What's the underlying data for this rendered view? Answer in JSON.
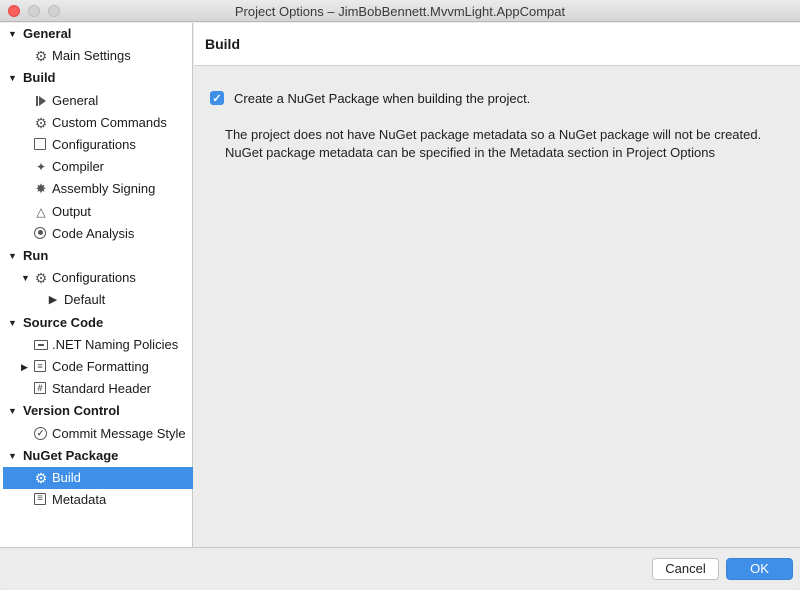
{
  "window": {
    "title": "Project Options – JimBobBennett.MvvmLight.AppCompat"
  },
  "sidebar": {
    "rows": [
      {
        "type": "section",
        "label": "General",
        "arrow": "down"
      },
      {
        "type": "item",
        "label": "Main Settings",
        "icon": "gear-icon"
      },
      {
        "type": "section",
        "label": "Build",
        "arrow": "down"
      },
      {
        "type": "item",
        "label": "General",
        "icon": "play-icon"
      },
      {
        "type": "item",
        "label": "Custom Commands",
        "icon": "gear-icon"
      },
      {
        "type": "item",
        "label": "Configurations",
        "icon": "window-icon"
      },
      {
        "type": "item",
        "label": "Compiler",
        "icon": "compiler-icon"
      },
      {
        "type": "item",
        "label": "Assembly Signing",
        "icon": "seal-icon"
      },
      {
        "type": "item",
        "label": "Output",
        "icon": "flask-icon"
      },
      {
        "type": "item",
        "label": "Code Analysis",
        "icon": "target-icon"
      },
      {
        "type": "section",
        "label": "Run",
        "arrow": "down"
      },
      {
        "type": "item",
        "label": "Configurations",
        "icon": "gear-icon",
        "arrow": "down"
      },
      {
        "type": "subitem",
        "label": "Default",
        "icon": "play-triangle-icon"
      },
      {
        "type": "section",
        "label": "Source Code",
        "arrow": "down"
      },
      {
        "type": "item",
        "label": ".NET Naming Policies",
        "icon": "naming-icon"
      },
      {
        "type": "item",
        "label": "Code Formatting",
        "icon": "formatting-icon",
        "arrow": "right"
      },
      {
        "type": "item",
        "label": "Standard Header",
        "icon": "hash-icon"
      },
      {
        "type": "section",
        "label": "Version Control",
        "arrow": "down"
      },
      {
        "type": "item",
        "label": "Commit Message Style",
        "icon": "check-circle-icon"
      },
      {
        "type": "section",
        "label": "NuGet Package",
        "arrow": "down"
      },
      {
        "type": "item",
        "label": "Build",
        "icon": "gear-icon",
        "selected": true
      },
      {
        "type": "item",
        "label": "Metadata",
        "icon": "document-icon"
      }
    ]
  },
  "main": {
    "title": "Build",
    "checkbox_label": "Create a NuGet Package when building the project.",
    "checkbox_checked": true,
    "info": "The project does not have NuGet package metadata so a NuGet package will not be created. NuGet package metadata can be specified in the Metadata section in Project Options"
  },
  "footer": {
    "cancel_label": "Cancel",
    "ok_label": "OK"
  },
  "colors": {
    "accent": "#3f8fe8",
    "close": "#fc605c"
  }
}
